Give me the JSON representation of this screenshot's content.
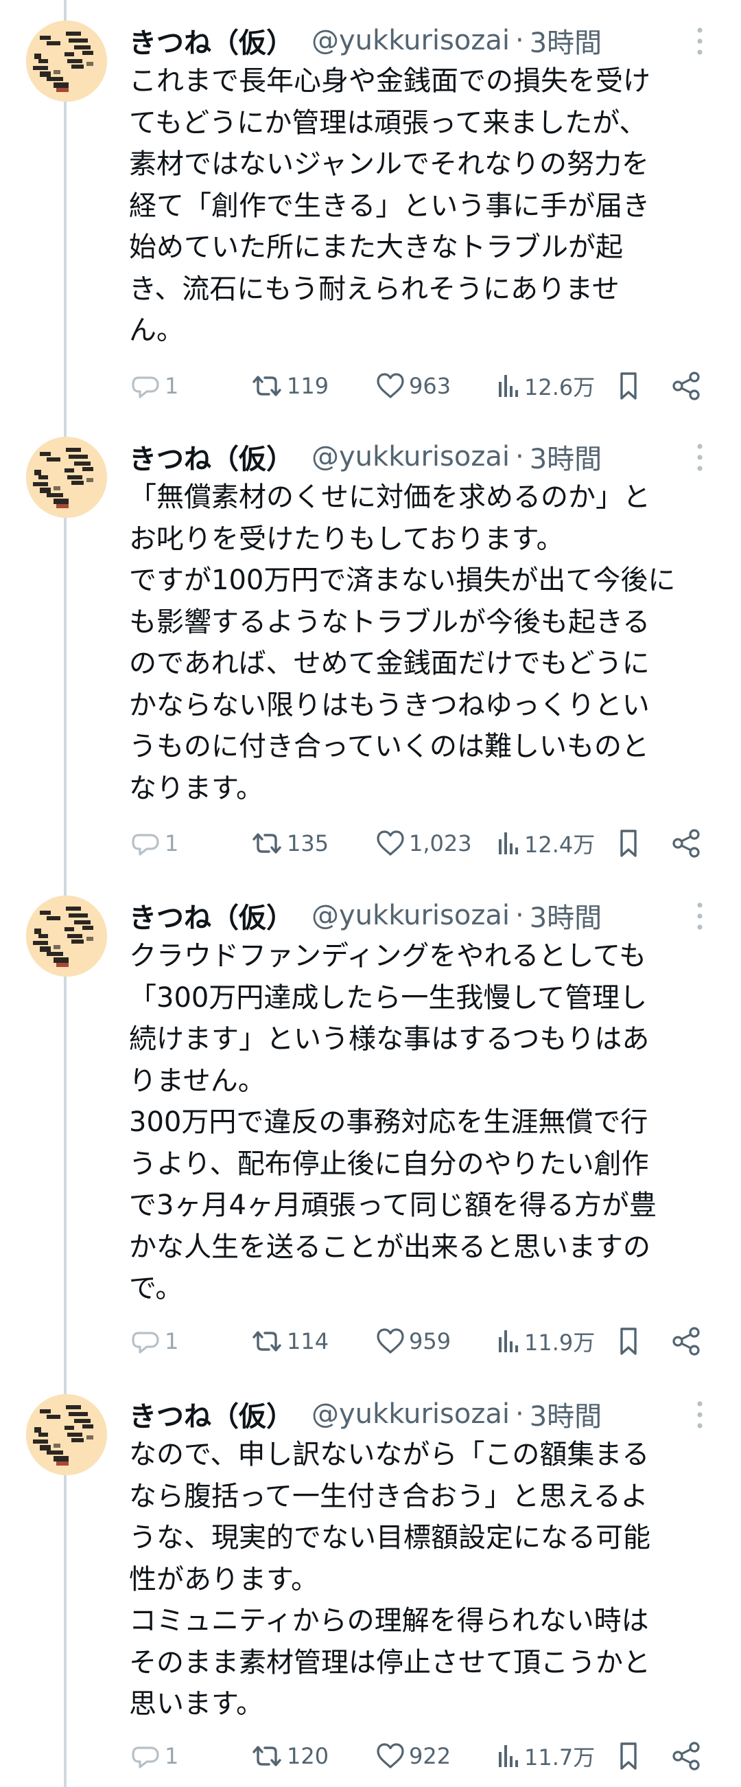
{
  "tweets": [
    {
      "display_name": "きつね（仮）",
      "handle": "@yukkurisozai",
      "separator": "·",
      "time": "3時間",
      "text": "これまで長年心身や金銭面での損失を受け\nてもどうにか管理は頑張って来ましたが、\n素材ではないジャンルでそれなりの努力を\n経て「創作で生きる」という事に手が届き\n始めていた所にまた大きなトラブルが起\nき、流石にもう耐えられそうにありませ\nん。",
      "replies": "1",
      "retweets": "119",
      "likes": "963",
      "views": "12.6万"
    },
    {
      "display_name": "きつね（仮）",
      "handle": "@yukkurisozai",
      "separator": "·",
      "time": "3時間",
      "text": "「無償素材のくせに対価を求めるのか」と\nお叱りを受けたりもしております。\nですが100万円で済まない損失が出て今後に\nも影響するようなトラブルが今後も起きる\nのであれば、せめて金銭面だけでもどうに\nかならない限りはもうきつねゆっくりとい\nうものに付き合っていくのは難しいものと\nなります。",
      "replies": "1",
      "retweets": "135",
      "likes": "1,023",
      "views": "12.4万"
    },
    {
      "display_name": "きつね（仮）",
      "handle": "@yukkurisozai",
      "separator": "·",
      "time": "3時間",
      "text": "クラウドファンディングをやれるとしても\n「300万円達成したら一生我慢して管理し\n続けます」という様な事はするつもりはあ\nりません。\n300万円で違反の事務対応を生涯無償で行\nうより、配布停止後に自分のやりたい創作\nで3ヶ月4ヶ月頑張って同じ額を得る方が豊\nかな人生を送ることが出来ると思いますの\nで。",
      "replies": "1",
      "retweets": "114",
      "likes": "959",
      "views": "11.9万"
    },
    {
      "display_name": "きつね（仮）",
      "handle": "@yukkurisozai",
      "separator": "·",
      "time": "3時間",
      "text": "なので、申し訳ないながら「この額集まる\nなら腹括って一生付き合おう」と思えるよ\nうな、現実的でない目標額設定になる可能\n性があります。\nコミュニティからの理解を得られない時は\nそのまま素材管理は停止させて頂こうかと\n思います。",
      "replies": "1",
      "retweets": "120",
      "likes": "922",
      "views": "11.7万"
    }
  ],
  "icons": {
    "avatar": "pixel-art-face-avatar",
    "more": "more-vertical-icon",
    "reply": "reply-icon",
    "retweet": "retweet-icon",
    "like": "heart-icon",
    "views": "views-icon",
    "bookmark": "bookmark-icon",
    "share": "share-icon"
  },
  "colors": {
    "text": "#0f1419",
    "secondary": "#536471",
    "thread_line": "#cfd9de",
    "avatar_bg": "#fbe1b5"
  }
}
